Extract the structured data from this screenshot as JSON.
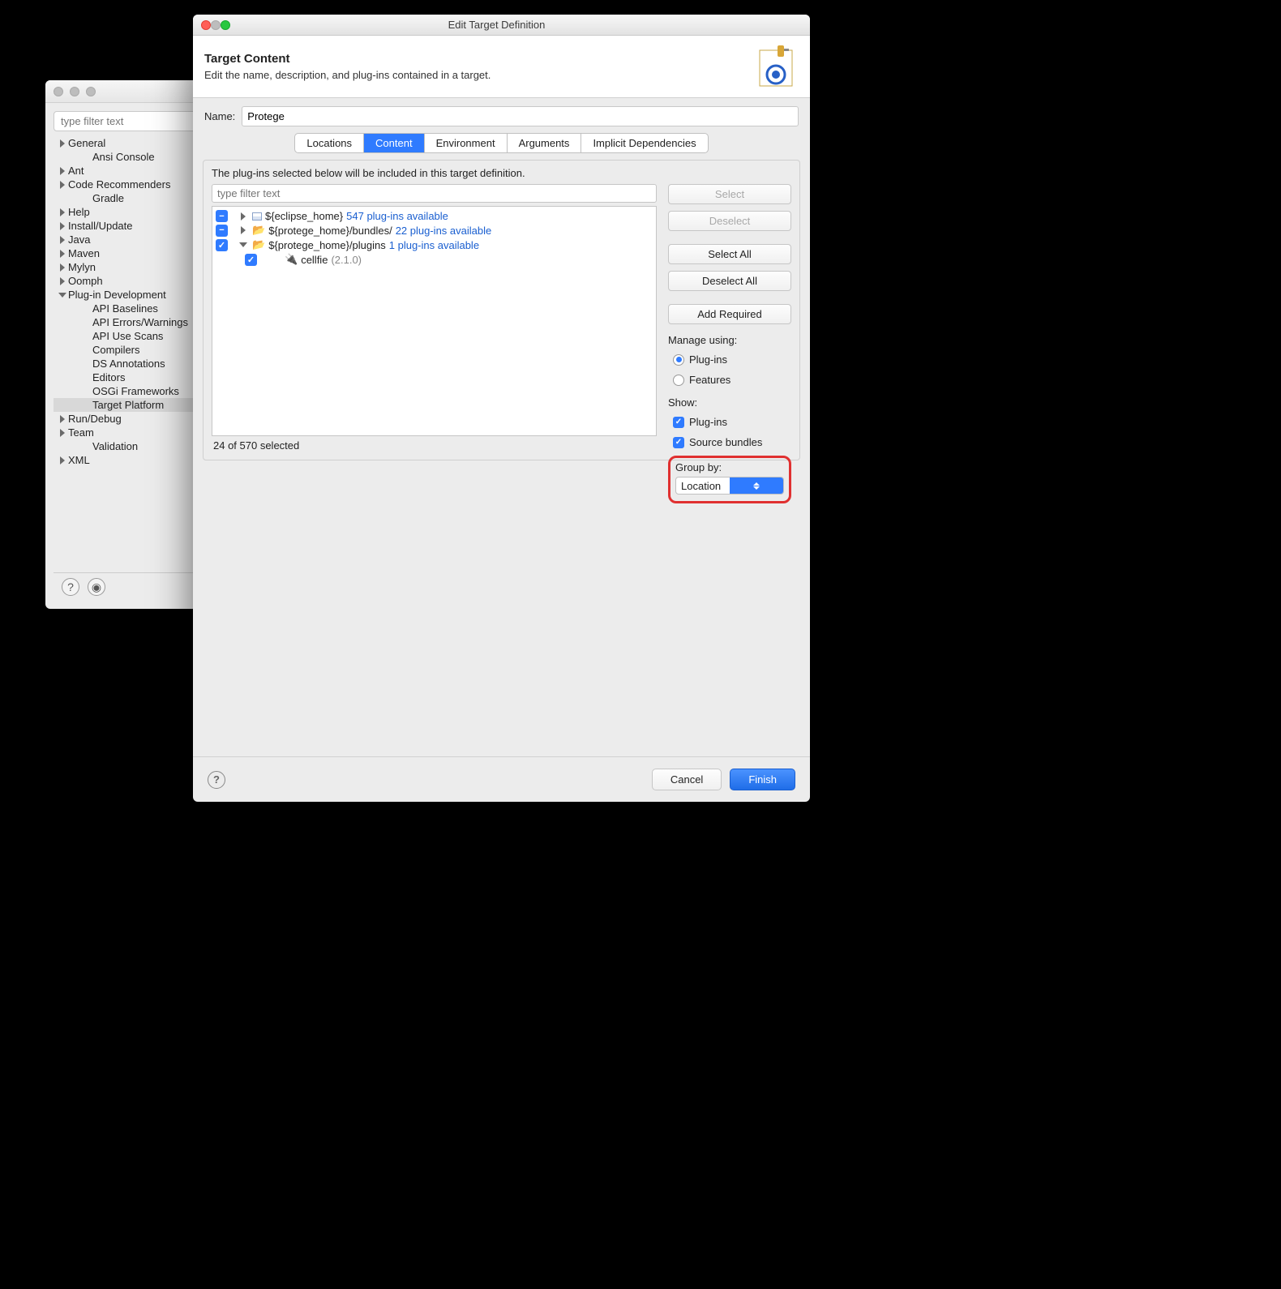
{
  "prefs": {
    "filter_placeholder": "type filter text",
    "items": [
      {
        "label": "General",
        "level": 1,
        "arrow": "right"
      },
      {
        "label": "Ansi Console",
        "level": 2,
        "arrow": "none"
      },
      {
        "label": "Ant",
        "level": 1,
        "arrow": "right"
      },
      {
        "label": "Code Recommenders",
        "level": 1,
        "arrow": "right"
      },
      {
        "label": "Gradle",
        "level": 2,
        "arrow": "none"
      },
      {
        "label": "Help",
        "level": 1,
        "arrow": "right"
      },
      {
        "label": "Install/Update",
        "level": 1,
        "arrow": "right"
      },
      {
        "label": "Java",
        "level": 1,
        "arrow": "right"
      },
      {
        "label": "Maven",
        "level": 1,
        "arrow": "right"
      },
      {
        "label": "Mylyn",
        "level": 1,
        "arrow": "right"
      },
      {
        "label": "Oomph",
        "level": 1,
        "arrow": "right"
      },
      {
        "label": "Plug-in Development",
        "level": 1,
        "arrow": "down"
      },
      {
        "label": "API Baselines",
        "level": 2,
        "arrow": "none"
      },
      {
        "label": "API Errors/Warnings",
        "level": 2,
        "arrow": "none"
      },
      {
        "label": "API Use Scans",
        "level": 2,
        "arrow": "none"
      },
      {
        "label": "Compilers",
        "level": 2,
        "arrow": "none"
      },
      {
        "label": "DS Annotations",
        "level": 2,
        "arrow": "none"
      },
      {
        "label": "Editors",
        "level": 2,
        "arrow": "none"
      },
      {
        "label": "OSGi Frameworks",
        "level": 2,
        "arrow": "none"
      },
      {
        "label": "Target Platform",
        "level": 2,
        "arrow": "none",
        "selected": true
      },
      {
        "label": "Run/Debug",
        "level": 1,
        "arrow": "right"
      },
      {
        "label": "Team",
        "level": 1,
        "arrow": "right"
      },
      {
        "label": "Validation",
        "level": 2,
        "arrow": "none"
      },
      {
        "label": "XML",
        "level": 1,
        "arrow": "right"
      }
    ]
  },
  "dialog": {
    "window_title": "Edit Target Definition",
    "header_title": "Target Content",
    "header_desc": "Edit the name, description, and plug-ins contained in a target.",
    "name_label": "Name:",
    "name_value": "Protege",
    "tabs": [
      "Locations",
      "Content",
      "Environment",
      "Arguments",
      "Implicit Dependencies"
    ],
    "active_tab": "Content",
    "content_desc": "The plug-ins selected below will be included in this target definition.",
    "filter_placeholder": "type filter text",
    "tree": [
      {
        "state": "ind",
        "arrow": "right",
        "icon": "grid",
        "label": "${eclipse_home}",
        "avail": "547 plug-ins available",
        "indent": 0
      },
      {
        "state": "ind",
        "arrow": "right",
        "icon": "folder",
        "label": "${protege_home}/bundles/",
        "avail": "22 plug-ins available",
        "indent": 0
      },
      {
        "state": "checked",
        "arrow": "down",
        "icon": "folder",
        "label": "${protege_home}/plugins",
        "avail": "1 plug-ins available",
        "indent": 0
      },
      {
        "state": "checked",
        "arrow": "none",
        "icon": "plug",
        "label": "cellfie",
        "ver": "(2.1.0)",
        "indent": 1
      }
    ],
    "buttons": {
      "select": "Select",
      "deselect": "Deselect",
      "select_all": "Select All",
      "deselect_all": "Deselect All",
      "add_required": "Add Required"
    },
    "manage_label": "Manage using:",
    "manage_plugins": "Plug-ins",
    "manage_features": "Features",
    "show_label": "Show:",
    "show_plugins": "Plug-ins",
    "show_sources": "Source bundles",
    "groupby_label": "Group by:",
    "groupby_value": "Location",
    "status": "24 of 570 selected",
    "cancel": "Cancel",
    "finish": "Finish"
  }
}
